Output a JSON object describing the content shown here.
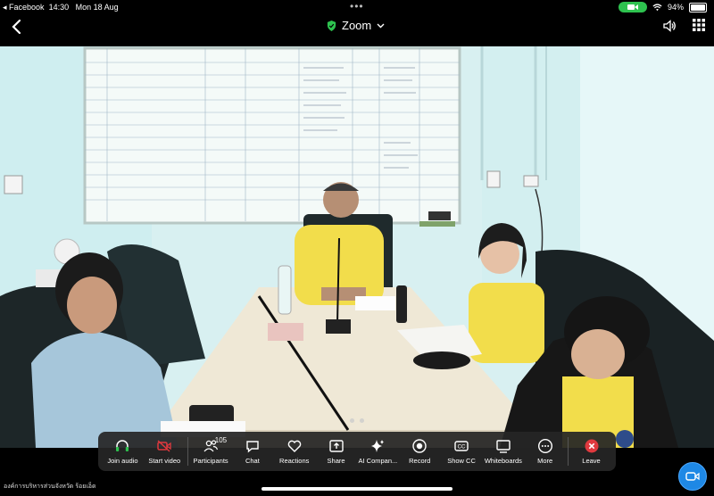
{
  "status": {
    "back_app": "◂ Facebook",
    "time": "14:30",
    "date": "Mon 18 Aug",
    "battery": "94%",
    "battery_level": 0.94
  },
  "header": {
    "title": "Zoom"
  },
  "toolbar": {
    "participants_count": "105",
    "items": [
      {
        "label": "Join audio",
        "icon": "headphones-icon"
      },
      {
        "label": "Start video",
        "icon": "video-off-icon"
      },
      {
        "label": "Participants",
        "icon": "participants-icon"
      },
      {
        "label": "Chat",
        "icon": "chat-icon"
      },
      {
        "label": "Reactions",
        "icon": "heart-icon"
      },
      {
        "label": "Share",
        "icon": "share-icon"
      },
      {
        "label": "AI Compan...",
        "icon": "sparkle-icon"
      },
      {
        "label": "Record",
        "icon": "record-icon"
      },
      {
        "label": "Show CC",
        "icon": "cc-icon"
      },
      {
        "label": "Whiteboards",
        "icon": "whiteboard-icon"
      },
      {
        "label": "More",
        "icon": "more-icon"
      },
      {
        "label": "Leave",
        "icon": "leave-icon"
      }
    ]
  },
  "bottom_caption": "องค์การบริหารส่วนจังหวัด ร้อยเอ็ด",
  "colors": {
    "accent": "#1e88e5",
    "leave": "#e0393e",
    "camera_active": "#2ec24f",
    "shield": "#2ec24f"
  }
}
